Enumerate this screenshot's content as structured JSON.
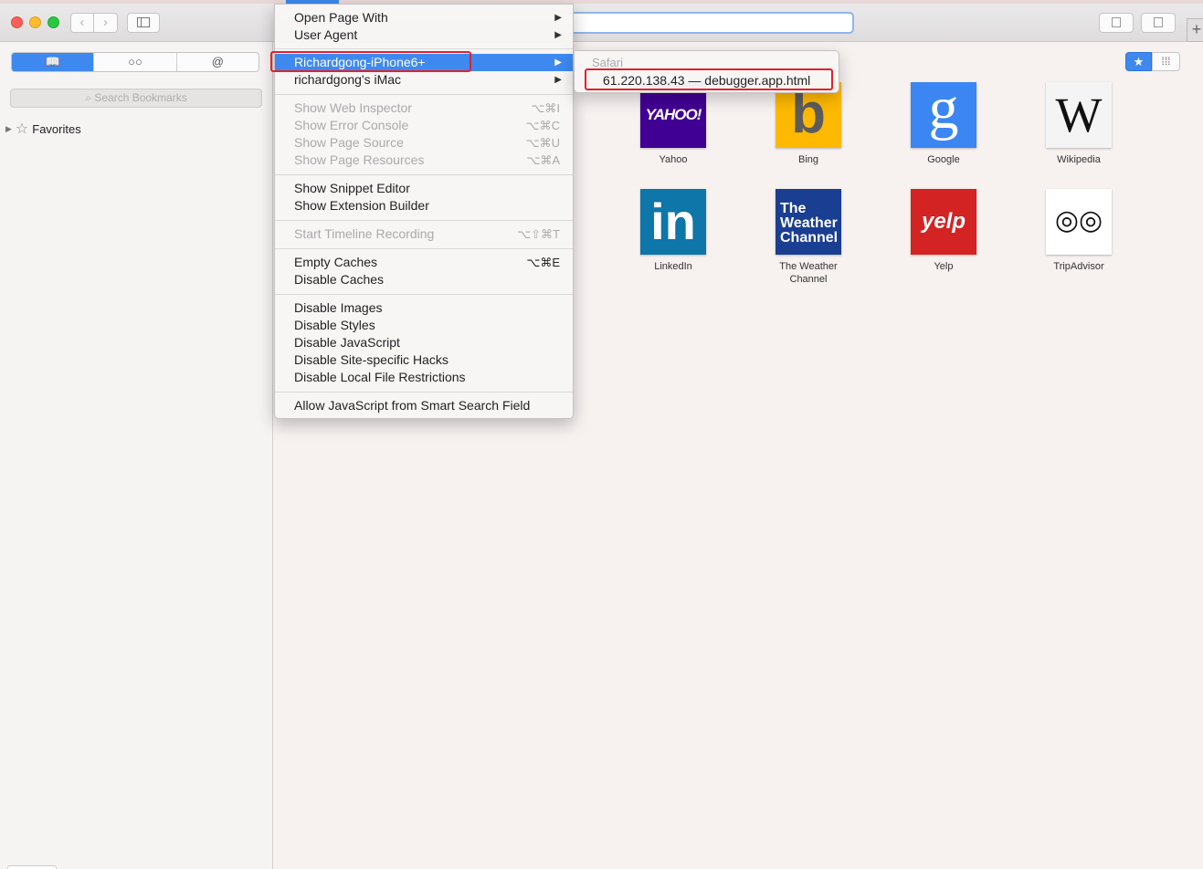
{
  "toolbar": {
    "back_icon": "‹",
    "forward_icon": "›",
    "new_tab_icon": "+"
  },
  "sidebar": {
    "tabs": [
      {
        "name": "bookmarks",
        "icon": "book-icon",
        "glyph": "📖"
      },
      {
        "name": "reading-list",
        "icon": "glasses-icon",
        "glyph": "○○"
      },
      {
        "name": "shared-links",
        "icon": "at-icon",
        "glyph": "@"
      }
    ],
    "search_placeholder": "Search Bookmarks",
    "favorites_label": "Favorites"
  },
  "view_controls": {
    "star_glyph": "★",
    "grid_glyph": "⁞⁞⁞"
  },
  "menu": {
    "items": [
      {
        "label": "Open Page With",
        "shortcut": "",
        "submenu": true,
        "disabled": false
      },
      {
        "label": "User Agent",
        "shortcut": "",
        "submenu": true,
        "disabled": false
      },
      {
        "label": "Richardgong-iPhone6+",
        "shortcut": "",
        "submenu": true,
        "disabled": false,
        "selected": true
      },
      {
        "label": "richardgong's iMac",
        "shortcut": "",
        "submenu": true,
        "disabled": false
      },
      {
        "label": "Show Web Inspector",
        "shortcut": "⌥⌘I",
        "disabled": true
      },
      {
        "label": "Show Error Console",
        "shortcut": "⌥⌘C",
        "disabled": true
      },
      {
        "label": "Show Page Source",
        "shortcut": "⌥⌘U",
        "disabled": true
      },
      {
        "label": "Show Page Resources",
        "shortcut": "⌥⌘A",
        "disabled": true
      },
      {
        "label": "Show Snippet Editor",
        "shortcut": "",
        "disabled": false
      },
      {
        "label": "Show Extension Builder",
        "shortcut": "",
        "disabled": false
      },
      {
        "label": "Start Timeline Recording",
        "shortcut": "⌥⇧⌘T",
        "disabled": true
      },
      {
        "label": "Empty Caches",
        "shortcut": "⌥⌘E",
        "disabled": false
      },
      {
        "label": "Disable Caches",
        "shortcut": "",
        "disabled": false
      },
      {
        "label": "Disable Images",
        "shortcut": "",
        "disabled": false
      },
      {
        "label": "Disable Styles",
        "shortcut": "",
        "disabled": false
      },
      {
        "label": "Disable JavaScript",
        "shortcut": "",
        "disabled": false
      },
      {
        "label": "Disable Site-specific Hacks",
        "shortcut": "",
        "disabled": false
      },
      {
        "label": "Disable Local File Restrictions",
        "shortcut": "",
        "disabled": false
      },
      {
        "label": "Allow JavaScript from Smart Search Field",
        "shortcut": "",
        "disabled": false
      }
    ],
    "submenu_arrow": "▶"
  },
  "submenu": {
    "header": "Safari",
    "item": "61.220.138.43 — debugger.app.html"
  },
  "favorites": [
    {
      "name": "Yahoo",
      "tile_text": "YAHOO!",
      "bg": "#410093",
      "fg": "#ffffff"
    },
    {
      "name": "Bing",
      "tile_text": "b",
      "bg": "#ffb900",
      "fg": "#5c5c5c"
    },
    {
      "name": "Google",
      "tile_text": "g",
      "bg": "#3c86f3",
      "fg": "#ffffff"
    },
    {
      "name": "Wikipedia",
      "tile_text": "W",
      "bg": "#f4f4f4",
      "fg": "#111111"
    },
    {
      "name": "LinkedIn",
      "tile_text": "in",
      "bg": "#0e76a8",
      "fg": "#ffffff"
    },
    {
      "name": "The Weather Channel",
      "tile_text": "The Weather Channel",
      "bg": "#1a3e92",
      "fg": "#ffffff"
    },
    {
      "name": "Yelp",
      "tile_text": "yelp",
      "bg": "#d32323",
      "fg": "#ffffff"
    },
    {
      "name": "TripAdvisor",
      "tile_text": "◎◎",
      "bg": "#ffffff",
      "fg": "#111111"
    }
  ],
  "colors": {
    "accent": "#3d89f0",
    "highlight_box": "#e2222a"
  }
}
